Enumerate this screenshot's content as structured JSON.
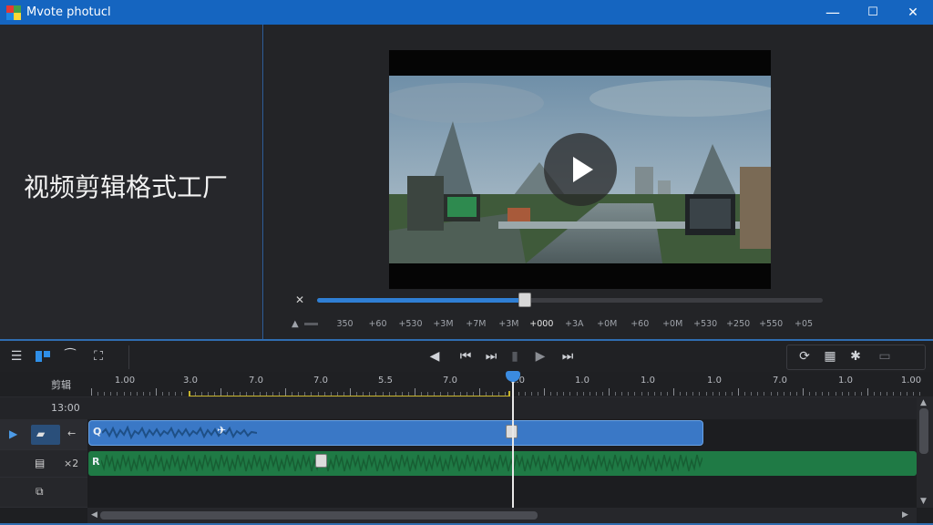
{
  "window": {
    "title": "Mvote photucl",
    "minimize": "—",
    "maximize": "☐",
    "close": "✕",
    "accent": "#1565c0"
  },
  "promo": {
    "text": "视频剪辑格式工厂"
  },
  "preview": {
    "progress": 0.41,
    "speed_labels": [
      "350",
      "+60",
      "+530",
      "+3M",
      "+7M",
      "+3M",
      "+000",
      "+3A",
      "+0M",
      "+60",
      "+0M",
      "+530",
      "+250",
      "+550",
      "+05"
    ]
  },
  "toolbar": {
    "left_icons": [
      "menu-icon",
      "layout-icon",
      "line-icon",
      "fit-icon"
    ],
    "transport": [
      "rewind-icon",
      "skip-back-icon",
      "step-forward-icon",
      "divider",
      "play-icon",
      "fast-forward-icon"
    ],
    "right_icons": [
      "loop-icon",
      "grid-icon",
      "star-icon",
      "screen-icon"
    ]
  },
  "timeline": {
    "ruler_label": "剪辑",
    "time_label": "13:00",
    "ticks": [
      {
        "label": "1.00",
        "pos": 0
      },
      {
        "label": "3.0",
        "pos": 0
      },
      {
        "label": "7.0",
        "pos": 0
      },
      {
        "label": "7.0",
        "pos": 0
      },
      {
        "label": "5.5",
        "pos": 0
      },
      {
        "label": "7.0",
        "pos": 0
      },
      {
        "label": "1.0",
        "pos": 0
      },
      {
        "label": "1.0",
        "pos": 0
      },
      {
        "label": "1.0",
        "pos": 0
      },
      {
        "label": "1.0",
        "pos": 0
      },
      {
        "label": "7.0",
        "pos": 0
      },
      {
        "label": "1.0",
        "pos": 0
      },
      {
        "label": "1.00",
        "pos": 0
      }
    ],
    "tracks": {
      "video_letter": "Q",
      "audio_letter": "R",
      "audio_head_label": "×2"
    }
  }
}
